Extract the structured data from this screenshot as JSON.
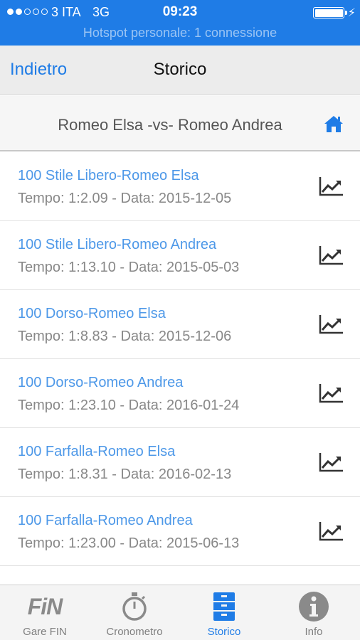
{
  "status_bar": {
    "carrier": "3 ITA",
    "network": "3G",
    "time": "09:23",
    "hotspot": "Hotspot personale: 1 connessione",
    "signal_bars": 2,
    "signal_total": 5
  },
  "nav": {
    "back_label": "Indietro",
    "title": "Storico"
  },
  "subheader": {
    "title": "Romeo Elsa -vs- Romeo Andrea",
    "home_icon": "home-icon"
  },
  "records": [
    {
      "name": "100 Stile Libero-Romeo Elsa",
      "meta": "Tempo: 1:2.09 - Data: 2015-12-05"
    },
    {
      "name": "100 Stile Libero-Romeo Andrea",
      "meta": "Tempo: 1:13.10 - Data: 2015-05-03"
    },
    {
      "name": "100 Dorso-Romeo Elsa",
      "meta": "Tempo: 1:8.83 - Data: 2015-12-06"
    },
    {
      "name": "100 Dorso-Romeo Andrea",
      "meta": "Tempo: 1:23.10 - Data: 2016-01-24"
    },
    {
      "name": "100 Farfalla-Romeo Elsa",
      "meta": "Tempo: 1:8.31 - Data: 2016-02-13"
    },
    {
      "name": "100 Farfalla-Romeo Andrea",
      "meta": "Tempo: 1:23.00 - Data: 2015-06-13"
    }
  ],
  "tabs": [
    {
      "label": "Gare FIN",
      "icon": "fin-logo-icon",
      "logo_text": "FiN",
      "active": false
    },
    {
      "label": "Cronometro",
      "icon": "stopwatch-icon",
      "active": false
    },
    {
      "label": "Storico",
      "icon": "archive-icon",
      "active": true
    },
    {
      "label": "Info",
      "icon": "info-icon",
      "active": false
    }
  ],
  "colors": {
    "accent": "#1f7ce6",
    "link": "#4d98e8",
    "muted": "#888888",
    "tab_inactive": "#7f7f7f"
  }
}
